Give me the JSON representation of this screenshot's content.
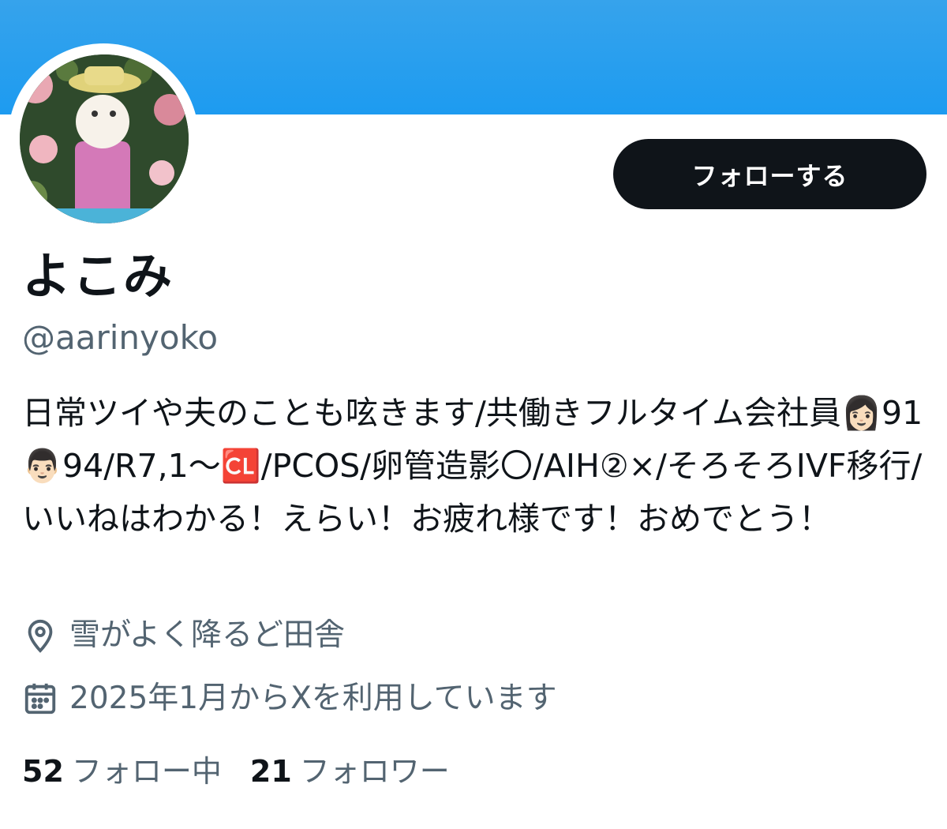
{
  "profile": {
    "display_name": "よこみ",
    "handle": "@aarinyoko",
    "bio": "日常ツイや夫のことも呟きます/共働きフルタイム会社員👩🏻91👨🏻94/R7,1〜🆑/PCOS/卵管造影〇/AIH②×/そろそろIVF移行/いいねはわかる！えらい！お疲れ様です！おめでとう！",
    "location": "雪がよく降るど田舎",
    "joined": "2025年1月からXを利用しています",
    "following_count": "52",
    "following_label": "フォロー中",
    "followers_count": "21",
    "followers_label": "フォロワー"
  },
  "actions": {
    "follow_label": "フォローする"
  },
  "icons": {
    "location": "location-pin-icon",
    "joined": "calendar-icon"
  },
  "colors": {
    "banner": "#1d9bf0",
    "button_bg": "#0f1419",
    "secondary_text": "#536471"
  }
}
